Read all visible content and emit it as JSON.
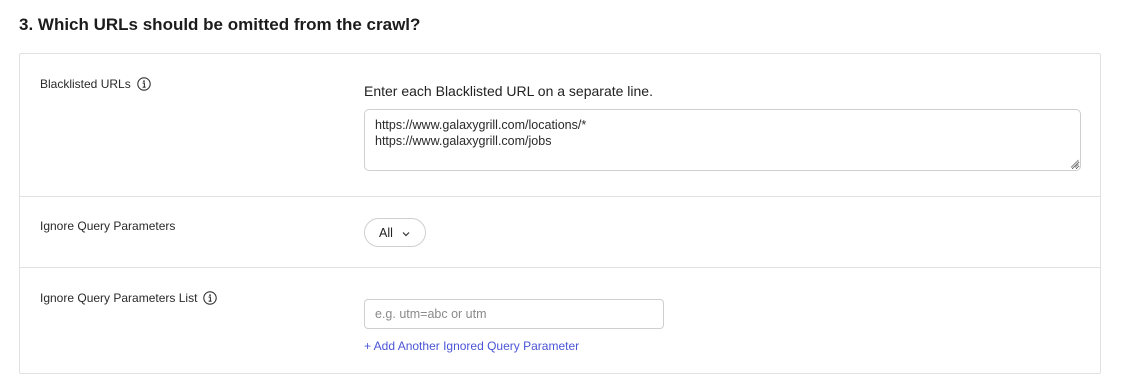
{
  "section": {
    "title": "3. Which URLs should be omitted from the crawl?"
  },
  "blacklist": {
    "label": "Blacklisted URLs",
    "info_icon": "info-icon",
    "instruction": "Enter each Blacklisted URL on a separate line.",
    "value": "https://www.galaxygrill.com/locations/*\nhttps://www.galaxygrill.com/jobs"
  },
  "ignore_query": {
    "label": "Ignore Query Parameters",
    "selected": "All",
    "chevron_icon": "chevron-down-icon"
  },
  "ignore_query_list": {
    "label": "Ignore Query Parameters List",
    "info_icon": "info-icon",
    "placeholder": "e.g. utm=abc or utm",
    "add_link": "+ Add Another Ignored Query Parameter"
  },
  "colors": {
    "link": "#4a55d6",
    "border": "#e1e1e1",
    "input_border": "#cfcfcf"
  }
}
